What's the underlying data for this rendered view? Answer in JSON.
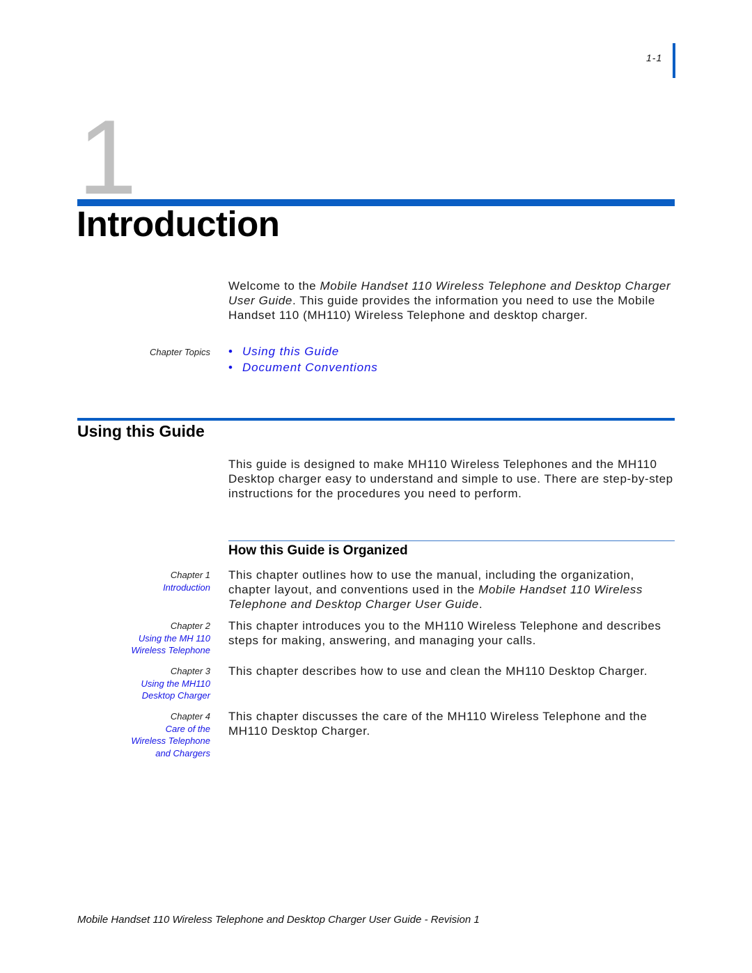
{
  "header": {
    "page_number": "1-1",
    "chapter_number": "1",
    "chapter_title": "Introduction"
  },
  "intro": {
    "text_before": "Welcome to the ",
    "italic_title": "Mobile Handset 110 Wireless Telephone and Desktop Charger User Guide",
    "text_after": ". This guide provides the information you need to use the Mobile Handset 110 (MH110) Wireless Telephone and desktop charger."
  },
  "chapter_topics": {
    "label": "Chapter Topics",
    "bullet_glyph": "•",
    "items": [
      {
        "label": "Using this Guide"
      },
      {
        "label": "Document Conventions"
      }
    ]
  },
  "using_guide": {
    "title": "Using this Guide",
    "text": "This guide is designed to make MH110 Wireless Telephones and the MH110 Desktop charger easy to understand and simple to use. There are step-by-step instructions for the procedures you need to perform."
  },
  "organization": {
    "title": "How this Guide is Organized",
    "chapters": [
      {
        "label": "Chapter 1",
        "link_lines": [
          "Introduction"
        ],
        "text_before": "This chapter outlines how to use the manual, including the organization, chapter layout, and conventions used in the ",
        "italic": "Mobile Handset 110 Wireless Telephone and Desktop Charger User Guide",
        "text_after": "."
      },
      {
        "label": "Chapter 2",
        "link_lines": [
          "Using the MH 110",
          "Wireless Telephone"
        ],
        "text_before": "This chapter introduces you to the MH110 Wireless Telephone and describes steps for making, answering, and managing your calls.",
        "italic": "",
        "text_after": ""
      },
      {
        "label": "Chapter 3",
        "link_lines": [
          "Using the MH110",
          "Desktop Charger"
        ],
        "text_before": "This chapter describes how to use and clean the MH110 Desktop Charger.",
        "italic": "",
        "text_after": ""
      },
      {
        "label": "Chapter 4",
        "link_lines": [
          "Care of the",
          "Wireless Telephone",
          "and Chargers"
        ],
        "text_before": "This chapter discusses the care of the MH110 Wireless Telephone and the MH110 Desktop Charger.",
        "italic": "",
        "text_after": ""
      }
    ]
  },
  "footer": {
    "text": "Mobile Handset 110 Wireless Telephone and Desktop Charger User Guide - Revision 1"
  },
  "colors": {
    "accent_blue": "#0a5ec4",
    "link_blue": "#1414e6",
    "chapter_number_gray": "#c0c0c0"
  }
}
